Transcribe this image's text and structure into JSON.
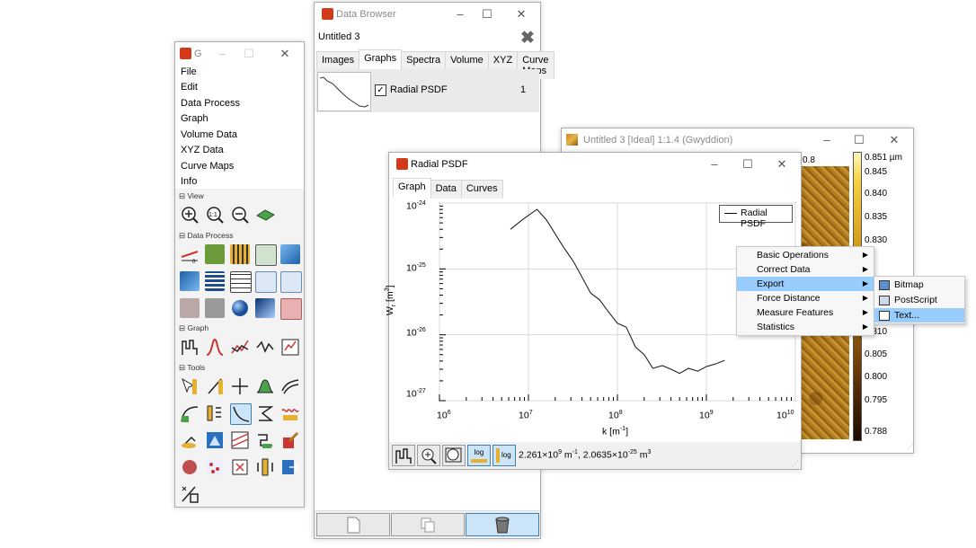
{
  "toolbox": {
    "title_glyph": "G",
    "menus": [
      "File",
      "Edit",
      "Data Process",
      "Graph",
      "Volume Data",
      "XYZ Data",
      "Curve Maps",
      "Info"
    ],
    "sections": {
      "view": "View",
      "data_process": "Data Process",
      "graph": "Graph",
      "tools": "Tools"
    }
  },
  "data_browser": {
    "title": "Data Browser",
    "file_name": "Untitled 3",
    "tabs": [
      "Images",
      "Graphs",
      "Spectra",
      "Volume",
      "XYZ",
      "Curve Maps"
    ],
    "selected_tab": "Graphs",
    "rows": [
      {
        "name": "Radial PSDF",
        "id": "1",
        "checked": true
      }
    ]
  },
  "image_window": {
    "title": "Untitled 3 [Ideal] 1:1.4 (Gwyddion)",
    "ruler_label": "0.8",
    "scale_labels": [
      "0.851 µm",
      "0.845",
      "0.840",
      "0.835",
      "0.830",
      "0.810",
      "0.805",
      "0.800",
      "0.795",
      "0.788"
    ]
  },
  "graph_window": {
    "title": "Radial PSDF",
    "tabs": [
      "Graph",
      "Data",
      "Curves"
    ],
    "selected_tab": "Graph",
    "legend": "Radial PSDF",
    "y_ticks": [
      {
        "base": "10",
        "exp": "-24"
      },
      {
        "base": "10",
        "exp": "-25"
      },
      {
        "base": "10",
        "exp": "-26"
      },
      {
        "base": "10",
        "exp": "-27"
      }
    ],
    "x_ticks": [
      {
        "base": "10",
        "exp": "6"
      },
      {
        "base": "10",
        "exp": "7"
      },
      {
        "base": "10",
        "exp": "8"
      },
      {
        "base": "10",
        "exp": "9"
      },
      {
        "base": "10",
        "exp": "10"
      }
    ],
    "x_label": {
      "main": "k [m",
      "exp": "-1",
      "close": "]"
    },
    "y_label": {
      "w": "W",
      "sub": "r",
      "open": " [m",
      "exp": "3",
      "close": "]"
    },
    "status": {
      "a": "2.261×10",
      "a_exp": "9",
      "b": " m",
      "b_exp": "-1",
      "c": ", 2.0635×10",
      "c_exp": "-25",
      "d": " m",
      "d_exp": "3"
    },
    "buttons": {
      "log": "log"
    }
  },
  "context_menu": {
    "items": [
      "Basic Operations",
      "Correct Data",
      "Export",
      "Force Distance",
      "Measure Features",
      "Statistics"
    ],
    "highlighted": "Export",
    "submenu": [
      "Bitmap",
      "PostScript",
      "Text..."
    ],
    "sub_highlighted": "Text..."
  },
  "chart_data": {
    "type": "line",
    "title": "",
    "xlabel": "k [m^-1]",
    "ylabel": "W_r [m^3]",
    "xscale": "log",
    "yscale": "log",
    "xlim": [
      1000000.0,
      10000000000.0
    ],
    "ylim": [
      1e-27,
      1e-24
    ],
    "grid": true,
    "legend": "top-right",
    "series": [
      {
        "name": "Radial PSDF",
        "x": [
          6300000.0,
          8000000.0,
          10000000.0,
          12500000.0,
          16000000.0,
          20000000.0,
          25000000.0,
          32000000.0,
          40000000.0,
          50000000.0,
          63000000.0,
          80000000.0,
          100000000.0,
          126000000.0,
          160000000.0,
          200000000.0,
          250000000.0,
          320000000.0,
          400000000.0,
          500000000.0,
          630000000.0,
          800000000.0,
          1000000000.0,
          1260000000.0,
          1600000000.0
        ],
        "y": [
          4e-25,
          5.2e-25,
          6.5e-25,
          8e-25,
          5.5e-25,
          3.4e-25,
          2.1e-25,
          1.3e-25,
          7.5e-26,
          4.3e-26,
          3.4e-26,
          2.2e-26,
          1.5e-26,
          1.3e-26,
          6.5e-27,
          5e-27,
          3.1e-27,
          3.4e-27,
          3e-27,
          2.6e-27,
          3.1e-27,
          2.8e-27,
          3.3e-27,
          3.6e-27,
          4.1e-27
        ]
      }
    ]
  }
}
